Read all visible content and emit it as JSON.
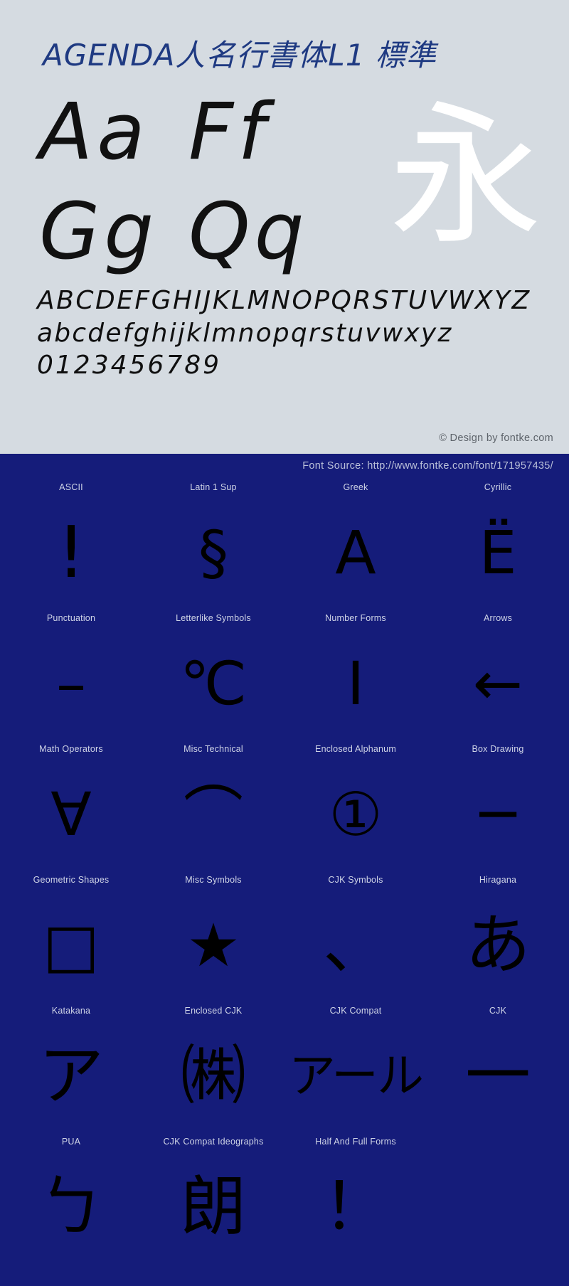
{
  "specimen": {
    "title": "AGENDA人名行書体L1  標準",
    "sample_pairs": [
      {
        "left": "Aa",
        "right": "Ff"
      },
      {
        "left": "Gg",
        "right": "Qq"
      }
    ],
    "watermark_glyph": "永",
    "uppercase": "ABCDEFGHIJKLMNOPQRSTUVWXYZ",
    "lowercase": "abcdefghijklmnopqrstuvwxyz",
    "digits": "0123456789",
    "credit": "© Design by fontke.com",
    "background_color": "#d5dbe1",
    "title_color": "#1f3a82"
  },
  "blocks_panel": {
    "source_label": "Font Source: http://www.fontke.com/font/171957435/",
    "background_color": "#151c7a",
    "label_color": "#cfd4e6",
    "glyph_color": "#000000",
    "cells": [
      {
        "label": "ASCII",
        "glyph": "!",
        "size": "tall"
      },
      {
        "label": "Latin 1 Sup",
        "glyph": "§",
        "size": "normal"
      },
      {
        "label": "Greek",
        "glyph": "Α",
        "size": "normal"
      },
      {
        "label": "Cyrillic",
        "glyph": "Ё",
        "size": "normal"
      },
      {
        "label": "Punctuation",
        "glyph": "–",
        "size": "normal"
      },
      {
        "label": "Letterlike Symbols",
        "glyph": "℃",
        "size": "normal"
      },
      {
        "label": "Number Forms",
        "glyph": "Ⅰ",
        "size": "normal"
      },
      {
        "label": "Arrows",
        "glyph": "←",
        "size": "normal"
      },
      {
        "label": "Math Operators",
        "glyph": "∀",
        "size": "normal"
      },
      {
        "label": "Misc Technical",
        "glyph": "⌒",
        "size": "normal"
      },
      {
        "label": "Enclosed Alphanum",
        "glyph": "①",
        "size": "normal"
      },
      {
        "label": "Box Drawing",
        "glyph": "─",
        "size": "normal"
      },
      {
        "label": "Geometric Shapes",
        "glyph": "□",
        "size": "normal"
      },
      {
        "label": "Misc Symbols",
        "glyph": "★",
        "size": "normal"
      },
      {
        "label": "CJK Symbols",
        "glyph": "、",
        "size": "cjk"
      },
      {
        "label": "Hiragana",
        "glyph": "あ",
        "size": "cjk"
      },
      {
        "label": "Katakana",
        "glyph": "ア",
        "size": "cjk"
      },
      {
        "label": "Enclosed CJK",
        "glyph": "㈱",
        "size": "cjk"
      },
      {
        "label": "CJK Compat",
        "glyph": "アール",
        "size": "multi"
      },
      {
        "label": "CJK",
        "glyph": "一",
        "size": "cjk"
      },
      {
        "label": "PUA",
        "glyph": "ㄅ",
        "size": "cjk"
      },
      {
        "label": "CJK Compat Ideographs",
        "glyph": "朗",
        "size": "cjk"
      },
      {
        "label": "Half And Full Forms",
        "glyph": "！",
        "size": "cjk"
      },
      {
        "label": "",
        "glyph": "",
        "size": "normal"
      }
    ]
  }
}
